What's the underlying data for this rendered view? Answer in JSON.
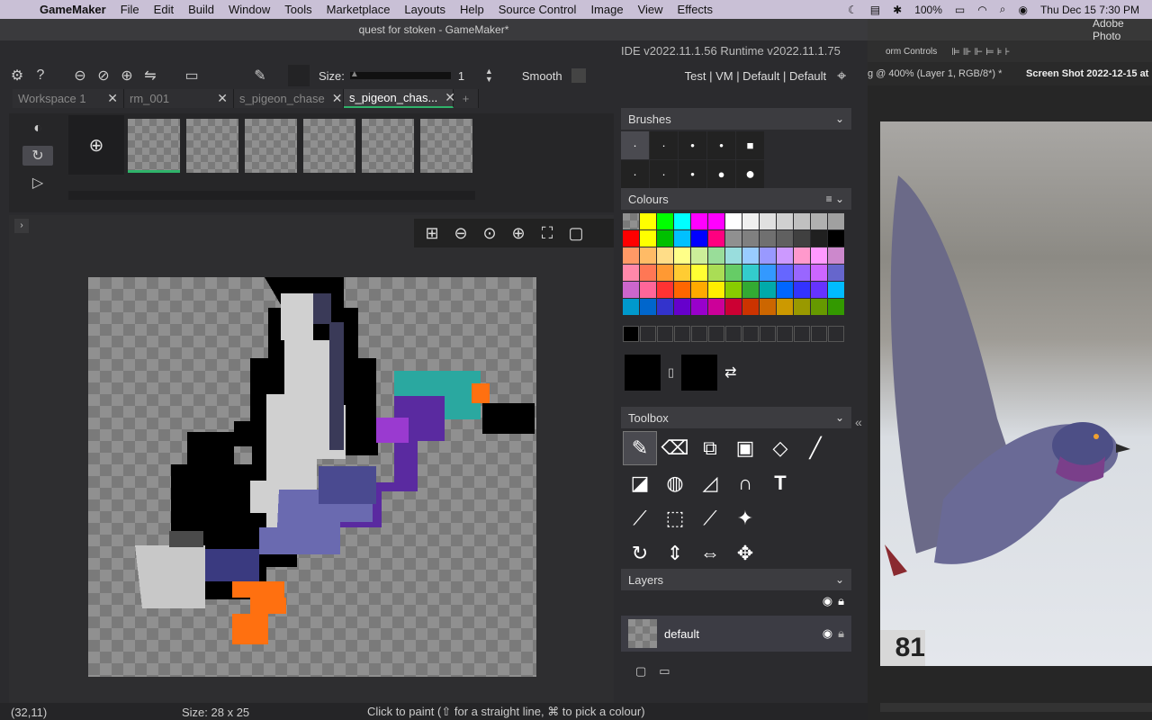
{
  "menubar": {
    "app": "GameMaker",
    "items": [
      "File",
      "Edit",
      "Build",
      "Window",
      "Tools",
      "Marketplace",
      "Layouts",
      "Help",
      "Source Control",
      "Image",
      "View",
      "Effects"
    ],
    "battery": "100%",
    "datetime": "Thu Dec 15  7:30 PM"
  },
  "window": {
    "title": "quest for stoken - GameMaker*",
    "ide_version": "IDE v2022.11.1.56  Runtime v2022.11.1.75"
  },
  "toolbar": {
    "size_label": "Size:",
    "size_value": "1",
    "smooth_label": "Smooth",
    "target": "Test | VM | Default | Default"
  },
  "tabs": [
    {
      "label": "Workspace 1"
    },
    {
      "label": "rm_001"
    },
    {
      "label": "s_pigeon_chase"
    },
    {
      "label": "s_pigeon_chas..."
    }
  ],
  "tab_add": "+",
  "frames_add": "⊕",
  "panels": {
    "brushes": "Brushes",
    "colours": "Colours",
    "toolbox": "Toolbox",
    "layers": "Layers",
    "layer_name": "default"
  },
  "status": {
    "coords": "(32,11)",
    "size": "Size: 28 x 25",
    "hint": "Click to paint (⇧ for a straight line, ⌘ to pick a colour)"
  },
  "photoshop": {
    "app": "Adobe Photo",
    "controls": "orm Controls",
    "doc_tab": "g @ 400% (Layer 1, RGB/8*) *",
    "screenshot_tab": "Screen Shot 2022-12-15 at",
    "overlay_number": "81"
  },
  "palette": [
    "#9a9a9a",
    "#ffff00",
    "#00ff00",
    "#00ffff",
    "#ff00ff",
    "#ff00ff",
    "#ffffff",
    "#f0f0f0",
    "#e0e0e0",
    "#d0d0d0",
    "#c0c0c0",
    "#b0b0b0",
    "#a0a0a0",
    "#ff0000",
    "#ffff00",
    "#00c000",
    "#00c0ff",
    "#0000ff",
    "#ff0080",
    "#909090",
    "#808080",
    "#707070",
    "#606060",
    "#404040",
    "#202020",
    "#000000",
    "#ff9966",
    "#ffbb66",
    "#ffdd88",
    "#ffff88",
    "#ccee99",
    "#99dd99",
    "#99dddd",
    "#99ccff",
    "#9999ff",
    "#cc99ff",
    "#ff99cc",
    "#ff99ff",
    "#cc88cc",
    "#ff88aa",
    "#ff7755",
    "#ff9933",
    "#ffcc33",
    "#ffff33",
    "#aadd55",
    "#66cc66",
    "#33cccc",
    "#3399ff",
    "#6666ff",
    "#9966ff",
    "#cc66ff",
    "#6666cc",
    "#cc66cc",
    "#ff6699",
    "#ff3333",
    "#ff6600",
    "#ffaa00",
    "#ffee00",
    "#88cc00",
    "#33aa33",
    "#00aaaa",
    "#0066ff",
    "#3333ff",
    "#6633ff",
    "#00bbff",
    "#0099cc",
    "#0066cc",
    "#3333cc",
    "#6600cc",
    "#9900cc",
    "#cc0099",
    "#cc0033",
    "#cc3300",
    "#cc6600",
    "#cc9900",
    "#999900",
    "#669900",
    "#339900"
  ]
}
